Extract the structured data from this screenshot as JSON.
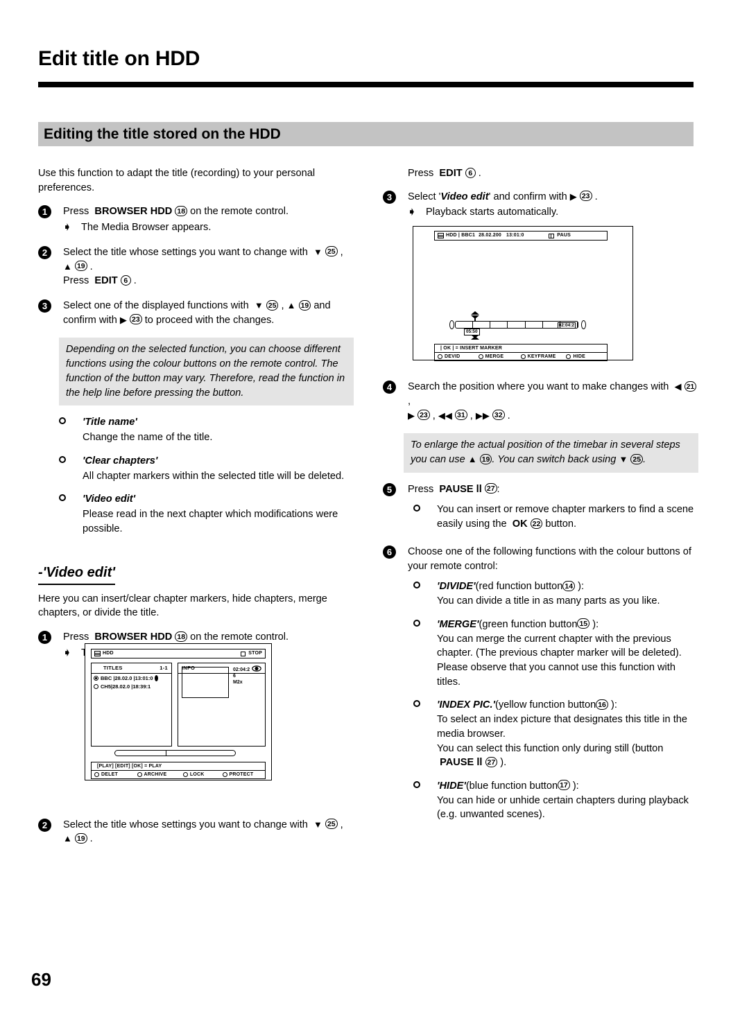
{
  "header": {
    "chapter_title": "Edit title on HDD",
    "section_band": "Editing the title stored on the HDD"
  },
  "page_number": "69",
  "left_column": {
    "intro": "Use this function to adapt the title (recording) to your personal preferences.",
    "steps": [
      {
        "num": "1",
        "text_before": "Press",
        "bold": "BROWSER HDD",
        "keyref": "18",
        "text_after": "on the remote control.",
        "sub": "The Media Browser appears."
      },
      {
        "num": "2",
        "line1": "Select the title whose settings you want to change with",
        "key_down": "25",
        "key_up": "19",
        "line2_before": "Press",
        "line2_bold": "EDIT",
        "line2_key": "6"
      },
      {
        "num": "3",
        "line1": "Select one of the displayed functions with",
        "key_down": "25",
        "key_up": "19",
        "line1_tail": "and",
        "line2_before": "confirm with",
        "key_right": "23",
        "line2_after": "to proceed with the changes."
      }
    ],
    "note": "Depending on the selected function, you can choose different functions using the colour buttons on the remote control. The function of the button may vary. Therefore, read the function in the help line before pressing the button.",
    "bullets": [
      {
        "title": "'Title name'",
        "body": "Change the name of the title."
      },
      {
        "title": "'Clear chapters'",
        "body": "All chapter markers within the selected title will be deleted."
      },
      {
        "title": "'Video edit'",
        "body": "Please read in the next chapter which modifications were possible."
      }
    ],
    "subsection": {
      "heading": "-'Video edit'",
      "body": "Here you can insert/clear chapter markers, hide chapters, merge chapters, or divide the title."
    },
    "subsection_steps": [
      {
        "num": "1",
        "text_before": "Press",
        "bold": "BROWSER HDD",
        "keyref": "18",
        "text_after": "on the remote control.",
        "sub": "The Media Browser appears."
      },
      {
        "num": "2",
        "line1": "Select the title whose settings you want to change with",
        "key_down": "25",
        "key_up": "19"
      }
    ]
  },
  "browser_screen": {
    "status_left": "HDD",
    "status_right": "STOP",
    "titles_header": "TITLES",
    "titles_count": "1-1",
    "rows": [
      {
        "name": "BBC",
        "date": "28.02.0",
        "time": "13:01:0",
        "selected": true
      },
      {
        "name": "CH5",
        "date": "28.02.0",
        "time": "18:39:1",
        "selected": false
      }
    ],
    "info_header": "INFO",
    "info_lines": [
      "02:04:2",
      "6",
      "M2x"
    ],
    "help_line": "[PLAY] [EDIT] [OK]  = PLAY",
    "color_buttons": [
      "DELET",
      "ARCHIVE",
      "LOCK",
      "PROTECT"
    ]
  },
  "video_screen": {
    "status_source": "HDD",
    "status_channel": "BBC1",
    "status_date": "28.02.200",
    "status_time": "13:01:0",
    "status_mode": "PAUS",
    "marker_time": "05:50",
    "total_time": "02:04:2",
    "help_line": "| OK | = INSERT  MARKER",
    "color_buttons": [
      "DEVID",
      "MERGE",
      "KEYFRAME",
      "HIDE"
    ]
  },
  "right_column": {
    "top_step_line": {
      "before": "Press",
      "bold": "EDIT",
      "key": "6"
    },
    "step3": {
      "num": "3",
      "before": "Select '",
      "italic_bold": "Video edit",
      "after": "' and confirm with",
      "key_right": "23",
      "sub": "Playback starts automatically."
    },
    "step4": {
      "num": "4",
      "line1": "Search the position where you want to make changes with",
      "key_left": "21",
      "key_right": "23",
      "key_prev": "31",
      "key_next": "32"
    },
    "note": {
      "part1": "To enlarge the actual position of the timebar in several steps you can use",
      "key_up": "19",
      "part2": ". You can switch back using",
      "key_down": "25",
      "part3": "."
    },
    "step5": {
      "num": "5",
      "before": "Press",
      "bold": "PAUSE ll",
      "key": "27",
      "after": ":",
      "bullet_line1": "You can insert or remove chapter markers to find a scene",
      "bullet_line2_before": "easily using the",
      "bullet_ok": "OK",
      "bullet_key": "22",
      "bullet_line2_after": "button."
    },
    "step6": {
      "num": "6",
      "intro": "Choose one of the following functions with the colour buttons of your remote control:",
      "functions": [
        {
          "name": "'DIVIDE'",
          "suffix": "(red function button",
          "key": "14",
          "suffix2": "):",
          "body": "You can divide a title in as many parts as you like."
        },
        {
          "name": "'MERGE'",
          "suffix": "(green function button",
          "key": "15",
          "suffix2": "):",
          "body": "You can merge the current chapter with the previous chapter. (The previous chapter marker will be deleted). Please observe that you cannot use this function with titles."
        },
        {
          "name": "'INDEX PIC.'",
          "suffix": "(yellow function button",
          "key": "16",
          "suffix2": "):",
          "body": "To select an index picture that designates this title in the media browser.",
          "body2": "You can select this function only during still (button",
          "body2_bold": "PAUSE ll",
          "body2_key": "27",
          "body2_tail": ")."
        },
        {
          "name": "'HIDE'",
          "suffix": "(blue function button",
          "key": "17",
          "suffix2": "):",
          "body": "You can hide or unhide certain chapters during playback (e.g. unwanted scenes)."
        }
      ]
    }
  }
}
